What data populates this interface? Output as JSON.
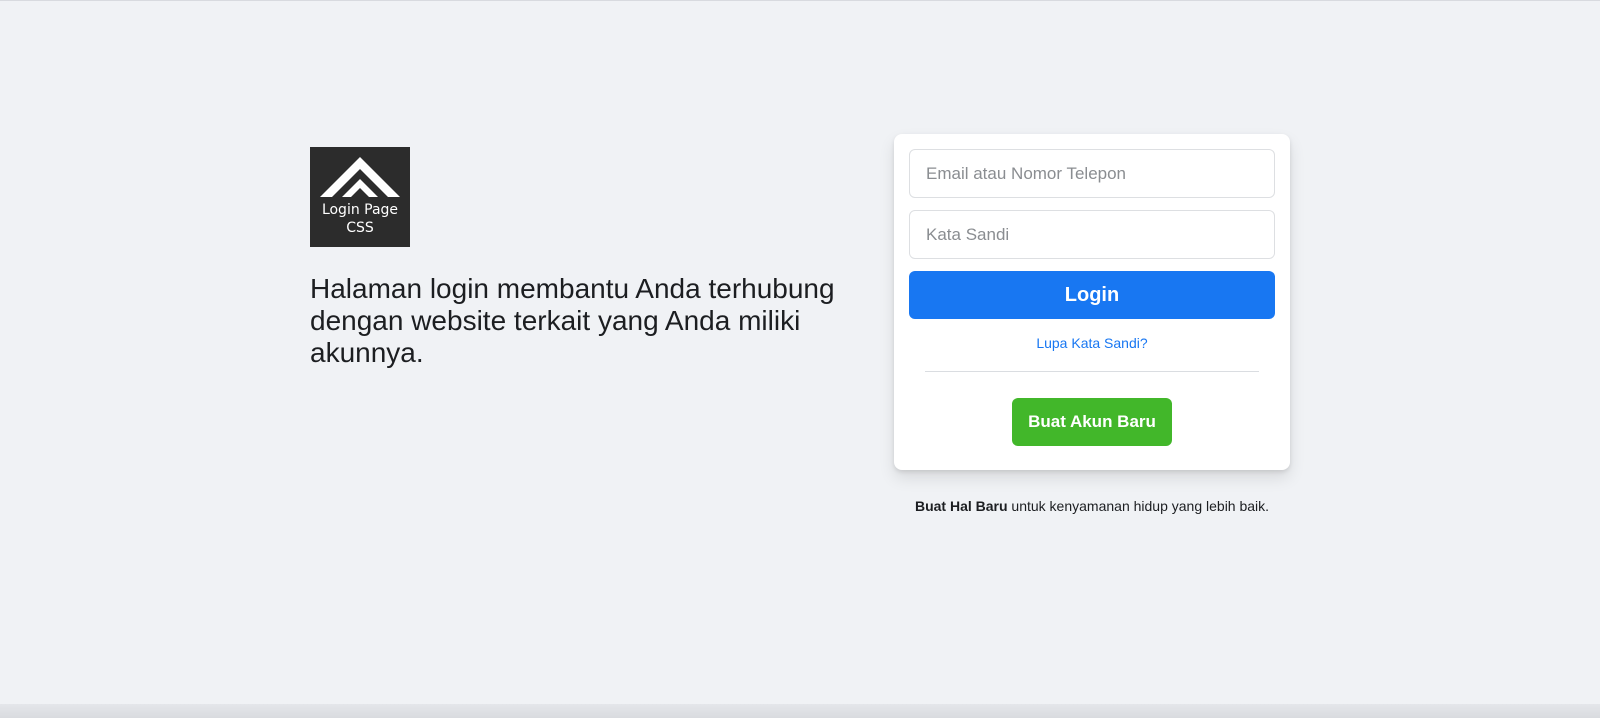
{
  "logo": {
    "line1": "Login Page",
    "line2": "CSS",
    "icon": "double-chevron-up-icon",
    "background": "#2c2c2c"
  },
  "tagline": "Halaman login membantu Anda terhubung dengan website terkait yang Anda miliki akunnya.",
  "form": {
    "email_placeholder": "Email atau Nomor Telepon",
    "email_value": "",
    "password_placeholder": "Kata Sandi",
    "password_value": "",
    "login_label": "Login",
    "forgot_label": "Lupa Kata Sandi?",
    "create_label": "Buat Akun Baru"
  },
  "footer": {
    "bold": "Buat Hal Baru",
    "rest": " untuk kenyamanan hidup yang lebih baik."
  },
  "colors": {
    "background": "#f0f2f5",
    "primary": "#1877f2",
    "success": "#42b72a"
  }
}
